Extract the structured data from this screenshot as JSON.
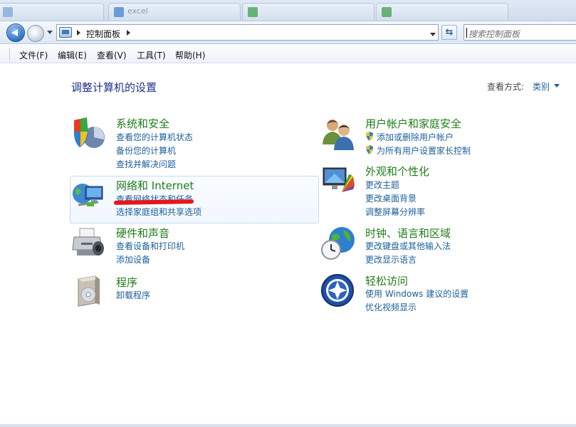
{
  "window": {
    "tabs": [
      {
        "label": "",
        "color": "#7aa7d8"
      },
      {
        "label": "excel",
        "color": "#3b7fd0"
      },
      {
        "label": "",
        "color": "#3e9e45"
      },
      {
        "label": "",
        "color": "#3e9e45"
      }
    ]
  },
  "navbar": {
    "breadcrumb": "控制面板",
    "search_placeholder": "搜索控制面板"
  },
  "menu": {
    "items": [
      "文件(F)",
      "编辑(E)",
      "查看(V)",
      "工具(T)",
      "帮助(H)"
    ]
  },
  "main": {
    "title": "调整计算机的设置",
    "view_by_label": "查看方式:",
    "view_by_value": "类别",
    "categories": [
      {
        "title": "系统和安全",
        "icon": "shield-pie-icon",
        "links": [
          "查看您的计算机状态",
          "备份您的计算机",
          "查找并解决问题"
        ]
      },
      {
        "title": "网络和 Internet",
        "icon": "network-globe-icon",
        "links": [
          "查看网络状态和任务",
          "选择家庭组和共享选项"
        ]
      },
      {
        "title": "硬件和声音",
        "icon": "printer-speaker-icon",
        "links": [
          "查看设备和打印机",
          "添加设备"
        ]
      },
      {
        "title": "程序",
        "icon": "programs-box-icon",
        "links": [
          "卸载程序"
        ]
      },
      {
        "title": "用户帐户和家庭安全",
        "icon": "users-icon",
        "links": [
          "添加或删除用户帐户",
          "为所有用户设置家长控制"
        ]
      },
      {
        "title": "外观和个性化",
        "icon": "monitor-palette-icon",
        "links": [
          "更改主题",
          "更改桌面背景",
          "调整屏幕分辨率"
        ]
      },
      {
        "title": "时钟、语言和区域",
        "icon": "globe-clock-icon",
        "links": [
          "更改键盘或其他输入法",
          "更改显示语言"
        ]
      },
      {
        "title": "轻松访问",
        "icon": "ease-of-access-icon",
        "links": [
          "使用 Windows 建议的设置",
          "优化视频显示"
        ]
      }
    ]
  },
  "colors": {
    "category_title": "#1e7d19",
    "link": "#1c5f9b",
    "heading": "#1e3287",
    "annotation": "#e8151b"
  }
}
